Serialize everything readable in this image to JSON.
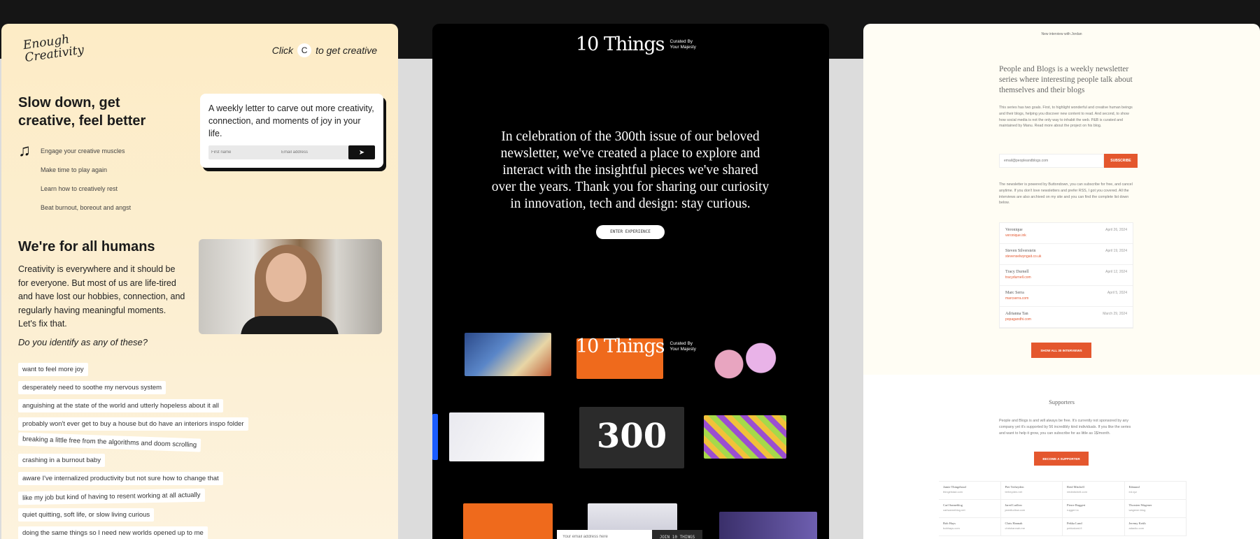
{
  "enough_creativity": {
    "logo": "Enough Creativity",
    "click_prefix": "Click",
    "click_key": "C",
    "click_suffix": "to get creative",
    "heading": "Slow down, get creative, feel better",
    "benefits": [
      "Engage your creative muscles",
      "Make time to play again",
      "Learn how to creatively rest",
      "Beat burnout, boreout and angst"
    ],
    "signup_text": "A weekly letter to carve out more creativity, connection, and moments of joy in your life.",
    "first_name_placeholder": "First name",
    "email_placeholder": "Email address",
    "section_heading": "We're for all humans",
    "section_body": "Creativity is everywhere and it should be for everyone. But most of us are life-tired and have lost our hobbies, connection, and regularly having meaningful moments. Let's fix that.",
    "question": "Do you identify as any of these?",
    "tags": [
      "want to feel more joy",
      "desperately need to soothe my nervous system",
      "anguishing at the state of the world and utterly hopeless about it all",
      "probably won't ever get to buy a house but do have an interiors inspo folder",
      "breaking a little free from the algorithms and doom scrolling",
      "crashing in a burnout baby",
      "aware I've internalized productivity but not sure how to change that",
      "like my job but kind of having to resent working at all actually",
      "quiet quitting, soft life, or slow living curious",
      "doing the same things so I need new worlds opened up to me"
    ]
  },
  "ten_things": {
    "logo_big": "10 Things",
    "logo_small": "Curated By Your Majesty",
    "message": "In celebration of the 300th issue of our beloved newsletter, we've created a place to explore and interact with the insightful pieces we've shared over the years. Thank you for sharing our curiosity in innovation, tech and design: stay curious.",
    "enter_button": "ENTER EXPERIENCE",
    "tile_300": "300",
    "email_placeholder": "Your email address here",
    "join_button": "JOIN 10 THINGS"
  },
  "people_and_blogs": {
    "top_line": "New interview with Jordan",
    "lead": "People and Blogs is a weekly newsletter series where interesting people talk about themselves and their blogs",
    "para1": "This series has two goals. First, to highlight wonderful and creative human beings and their blogs, helping you discover new content to read. And second, to show how social media is not the only way to inhabit the web. P&B is curated and maintained by Manu. Read more about the project on his blog.",
    "email_placeholder": "email@peopleandblogs.com",
    "subscribe": "SUBSCRIBE",
    "para2": "The newsletter is powered by Buttondown, you can subscribe for free, and cancel anytime. If you don't love newsletters and prefer RSS, I got you covered. All the interviews are also archived on my site and you can find the complete list down below.",
    "interviews": [
      {
        "name": "Veronique",
        "site": "veronique.ink",
        "date": "April 26, 2024"
      },
      {
        "name": "Steven Silverstein",
        "site": "stevenselwyngait.co.uk",
        "date": "April 19, 2024"
      },
      {
        "name": "Tracy Durnell",
        "site": "tracydurnell.com",
        "date": "April 12, 2024"
      },
      {
        "name": "Marc Serra",
        "site": "marcserra.com",
        "date": "April 5, 2024"
      },
      {
        "name": "Adrianna Tan",
        "site": "popagandhi.com",
        "date": "March 29, 2024"
      }
    ],
    "show_all": "SHOW ALL 30 INTERVIEWS",
    "supporters_heading": "Supporters",
    "supporters_text": "People and Blogs is and will always be free. It's currently not sponsored by any company yet it's supported by 56 incredibly kind individuals. If you like the series and want to help it grow, you can subscribe for as little as 1$/month.",
    "become_supporter": "BECOME A SUPPORTER",
    "supporters": [
      {
        "name": "Jamie Thingelstad",
        "site": "thingelstad.com"
      },
      {
        "name": "Piet Terheyden",
        "site": "terheyden.net"
      },
      {
        "name": "Reid Mitchell",
        "site": "reidmitchell.com"
      },
      {
        "name": "Edmund",
        "site": "ed.xyz"
      },
      {
        "name": "Carl Sanneblog",
        "site": "carlsanneblog.net"
      },
      {
        "name": "Jared Ludlow",
        "site": "jaredludlow.com"
      },
      {
        "name": "Pierre Ruggeri",
        "site": "ruggeri.io"
      },
      {
        "name": "Thorsten Wagener",
        "site": "wagener.blog"
      },
      {
        "name": "Bob Hays",
        "site": "bobhays.com"
      },
      {
        "name": "Chris Hannah",
        "site": "chrishannah.me"
      },
      {
        "name": "Pekka Lund",
        "site": "pekkalund.fi"
      },
      {
        "name": "Jeremy Keith",
        "site": "adactio.com"
      }
    ]
  }
}
